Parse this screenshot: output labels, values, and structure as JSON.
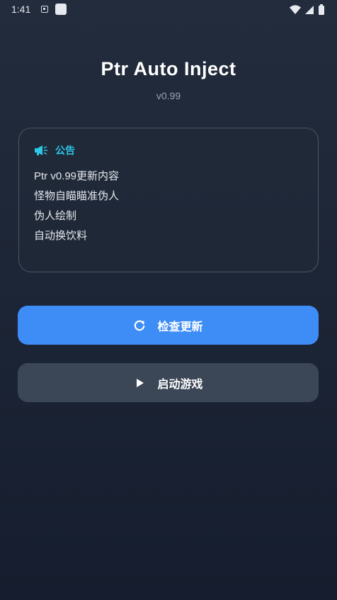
{
  "status_bar": {
    "time": "1:41",
    "icons": [
      "notification-icon",
      "app-notification-icon",
      "wifi-icon",
      "cellular-signal-icon",
      "battery-icon"
    ]
  },
  "app": {
    "title": "Ptr Auto Inject",
    "version": "v0.99"
  },
  "notice": {
    "icon": "megaphone-icon",
    "title": "公告",
    "lines": [
      "Ptr v0.99更新内容",
      "怪物自瞄瞄准伪人",
      "伪人绘制",
      "自动换饮料"
    ]
  },
  "buttons": {
    "update": {
      "label": "检查更新",
      "icon": "refresh-icon",
      "color": "#3e8df7"
    },
    "launch": {
      "label": "启动游戏",
      "icon": "play-icon",
      "color": "#3b4656"
    }
  },
  "colors": {
    "accent": "#2cc6e6",
    "background_top": "#222c3c",
    "background_bottom": "#151d2e"
  }
}
